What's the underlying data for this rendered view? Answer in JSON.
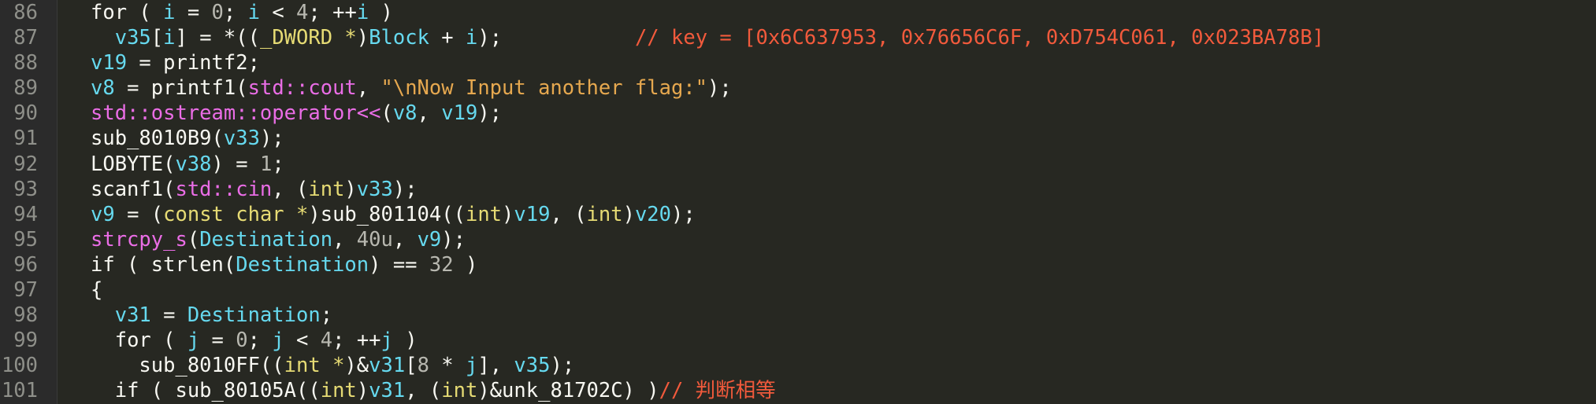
{
  "colors": {
    "background": "#272822",
    "plain": "#f8f8f2",
    "variable": "#66d9ef",
    "type": "#e6db74",
    "namespace": "#ea6de6",
    "number": "#b8b8b0",
    "string": "#e6a84f",
    "comment": "#f25a3c",
    "line_number": "#8f908a"
  },
  "lines": [
    {
      "number": "86",
      "indent": 4,
      "tokens": [
        {
          "t": "for ( ",
          "c": "plain"
        },
        {
          "t": "i",
          "c": "var"
        },
        {
          "t": " = ",
          "c": "plain"
        },
        {
          "t": "0",
          "c": "num"
        },
        {
          "t": "; ",
          "c": "plain"
        },
        {
          "t": "i",
          "c": "var"
        },
        {
          "t": " < ",
          "c": "plain"
        },
        {
          "t": "4",
          "c": "num"
        },
        {
          "t": "; ++",
          "c": "plain"
        },
        {
          "t": "i",
          "c": "var"
        },
        {
          "t": " )",
          "c": "plain"
        }
      ]
    },
    {
      "number": "87",
      "indent": 6,
      "tokens": [
        {
          "t": "v35",
          "c": "var"
        },
        {
          "t": "[",
          "c": "plain"
        },
        {
          "t": "i",
          "c": "var"
        },
        {
          "t": "] = *((",
          "c": "plain"
        },
        {
          "t": "_DWORD *",
          "c": "type"
        },
        {
          "t": ")",
          "c": "plain"
        },
        {
          "t": "Block",
          "c": "var"
        },
        {
          "t": " + ",
          "c": "plain"
        },
        {
          "t": "i",
          "c": "var"
        },
        {
          "t": ");           ",
          "c": "plain"
        },
        {
          "t": "// key = [0x6C637953, 0x76656C6F, 0xD754C061, 0x023BA78B]",
          "c": "comment"
        }
      ]
    },
    {
      "number": "88",
      "indent": 4,
      "tokens": [
        {
          "t": "v19",
          "c": "var"
        },
        {
          "t": " = printf2;",
          "c": "plain"
        }
      ]
    },
    {
      "number": "89",
      "indent": 4,
      "tokens": [
        {
          "t": "v8",
          "c": "var"
        },
        {
          "t": " = printf1(",
          "c": "plain"
        },
        {
          "t": "std::cout",
          "c": "ns"
        },
        {
          "t": ", ",
          "c": "plain"
        },
        {
          "t": "\"\\nNow Input another flag:\"",
          "c": "str"
        },
        {
          "t": ");",
          "c": "plain"
        }
      ]
    },
    {
      "number": "90",
      "indent": 4,
      "tokens": [
        {
          "t": "std::ostream::operator<<",
          "c": "ns"
        },
        {
          "t": "(",
          "c": "plain"
        },
        {
          "t": "v8",
          "c": "var"
        },
        {
          "t": ", ",
          "c": "plain"
        },
        {
          "t": "v19",
          "c": "var"
        },
        {
          "t": ");",
          "c": "plain"
        }
      ]
    },
    {
      "number": "91",
      "indent": 4,
      "tokens": [
        {
          "t": "sub_8010B9(",
          "c": "plain"
        },
        {
          "t": "v33",
          "c": "var"
        },
        {
          "t": ");",
          "c": "plain"
        }
      ]
    },
    {
      "number": "92",
      "indent": 4,
      "tokens": [
        {
          "t": "LOBYTE(",
          "c": "plain"
        },
        {
          "t": "v38",
          "c": "var"
        },
        {
          "t": ") = ",
          "c": "plain"
        },
        {
          "t": "1",
          "c": "num"
        },
        {
          "t": ";",
          "c": "plain"
        }
      ]
    },
    {
      "number": "93",
      "indent": 4,
      "tokens": [
        {
          "t": "scanf1(",
          "c": "plain"
        },
        {
          "t": "std::cin",
          "c": "ns"
        },
        {
          "t": ", (",
          "c": "plain"
        },
        {
          "t": "int",
          "c": "type"
        },
        {
          "t": ")",
          "c": "plain"
        },
        {
          "t": "v33",
          "c": "var"
        },
        {
          "t": ");",
          "c": "plain"
        }
      ]
    },
    {
      "number": "94",
      "indent": 4,
      "tokens": [
        {
          "t": "v9",
          "c": "var"
        },
        {
          "t": " = (",
          "c": "plain"
        },
        {
          "t": "const char *",
          "c": "type"
        },
        {
          "t": ")sub_801104((",
          "c": "plain"
        },
        {
          "t": "int",
          "c": "type"
        },
        {
          "t": ")",
          "c": "plain"
        },
        {
          "t": "v19",
          "c": "var"
        },
        {
          "t": ", (",
          "c": "plain"
        },
        {
          "t": "int",
          "c": "type"
        },
        {
          "t": ")",
          "c": "plain"
        },
        {
          "t": "v20",
          "c": "var"
        },
        {
          "t": ");",
          "c": "plain"
        }
      ]
    },
    {
      "number": "95",
      "indent": 4,
      "tokens": [
        {
          "t": "strcpy_s",
          "c": "ns"
        },
        {
          "t": "(",
          "c": "plain"
        },
        {
          "t": "Destination",
          "c": "var"
        },
        {
          "t": ", ",
          "c": "plain"
        },
        {
          "t": "40u",
          "c": "num"
        },
        {
          "t": ", ",
          "c": "plain"
        },
        {
          "t": "v9",
          "c": "var"
        },
        {
          "t": ");",
          "c": "plain"
        }
      ]
    },
    {
      "number": "96",
      "indent": 4,
      "tokens": [
        {
          "t": "if ( strlen(",
          "c": "plain"
        },
        {
          "t": "Destination",
          "c": "var"
        },
        {
          "t": ") == ",
          "c": "plain"
        },
        {
          "t": "32",
          "c": "num"
        },
        {
          "t": " )",
          "c": "plain"
        }
      ]
    },
    {
      "number": "97",
      "indent": 4,
      "tokens": [
        {
          "t": "{",
          "c": "plain"
        }
      ]
    },
    {
      "number": "98",
      "indent": 6,
      "tokens": [
        {
          "t": "v31",
          "c": "var"
        },
        {
          "t": " = ",
          "c": "plain"
        },
        {
          "t": "Destination",
          "c": "var"
        },
        {
          "t": ";",
          "c": "plain"
        }
      ]
    },
    {
      "number": "99",
      "indent": 6,
      "tokens": [
        {
          "t": "for ( ",
          "c": "plain"
        },
        {
          "t": "j",
          "c": "var"
        },
        {
          "t": " = ",
          "c": "plain"
        },
        {
          "t": "0",
          "c": "num"
        },
        {
          "t": "; ",
          "c": "plain"
        },
        {
          "t": "j",
          "c": "var"
        },
        {
          "t": " < ",
          "c": "plain"
        },
        {
          "t": "4",
          "c": "num"
        },
        {
          "t": "; ++",
          "c": "plain"
        },
        {
          "t": "j",
          "c": "var"
        },
        {
          "t": " )",
          "c": "plain"
        }
      ]
    },
    {
      "number": "100",
      "indent": 8,
      "tokens": [
        {
          "t": "sub_8010FF((",
          "c": "plain"
        },
        {
          "t": "int *",
          "c": "type"
        },
        {
          "t": ")&",
          "c": "plain"
        },
        {
          "t": "v31",
          "c": "var"
        },
        {
          "t": "[",
          "c": "plain"
        },
        {
          "t": "8",
          "c": "num"
        },
        {
          "t": " * ",
          "c": "plain"
        },
        {
          "t": "j",
          "c": "var"
        },
        {
          "t": "], ",
          "c": "plain"
        },
        {
          "t": "v35",
          "c": "var"
        },
        {
          "t": ");",
          "c": "plain"
        }
      ]
    },
    {
      "number": "101",
      "indent": 6,
      "tokens": [
        {
          "t": "if ( sub_80105A((",
          "c": "plain"
        },
        {
          "t": "int",
          "c": "type"
        },
        {
          "t": ")",
          "c": "plain"
        },
        {
          "t": "v31",
          "c": "var"
        },
        {
          "t": ", (",
          "c": "plain"
        },
        {
          "t": "int",
          "c": "type"
        },
        {
          "t": ")&unk_81702C) )",
          "c": "plain"
        },
        {
          "t": "// 判断相等",
          "c": "comment"
        }
      ]
    }
  ]
}
